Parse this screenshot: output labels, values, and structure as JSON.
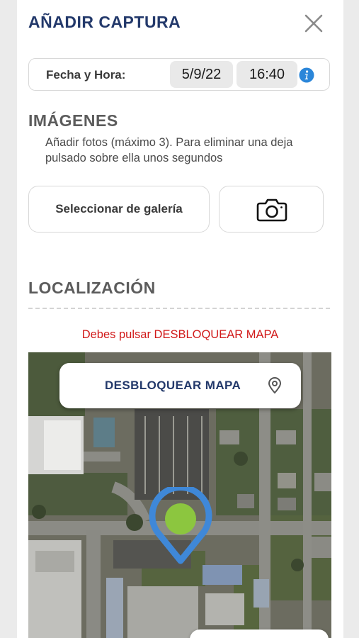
{
  "header": {
    "title": "AÑADIR CAPTURA",
    "close_icon": "close-icon"
  },
  "datetime": {
    "label": "Fecha y Hora:",
    "date": "5/9/22",
    "time": "16:40",
    "info_icon": "info-icon"
  },
  "images": {
    "title": "IMÁGENES",
    "description": "Añadir fotos (máximo 3). Para eliminar una deja pulsado sobre ella unos segundos",
    "gallery_button": "Seleccionar de galería",
    "camera_icon": "camera-icon"
  },
  "location": {
    "title": "LOCALIZACIÓN",
    "warning": "Debes pulsar DESBLOQUEAR MAPA",
    "unlock_button": "DESBLOQUEAR MAPA",
    "pin_icon": "map-pin-icon",
    "marker_icon": "map-marker-icon"
  },
  "colors": {
    "primary": "#23396b",
    "warning": "#d11a1a",
    "info": "#2b86d9",
    "marker_outline": "#3f88d8",
    "marker_fill": "#8cc63f"
  }
}
